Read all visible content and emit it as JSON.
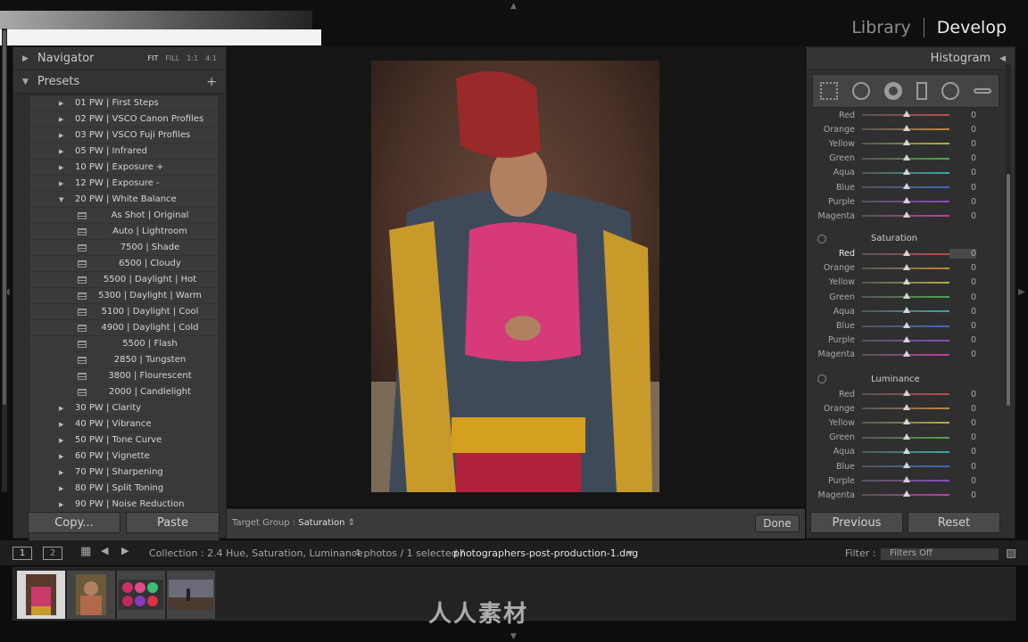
{
  "header": {
    "library": "Library",
    "develop": "Develop"
  },
  "navigator": {
    "title": "Navigator",
    "zoom": [
      "FIT",
      "FILL",
      "1:1",
      "4:1"
    ]
  },
  "presets": {
    "title": "Presets",
    "items": [
      {
        "label": "01 PW | First Steps",
        "type": "folder"
      },
      {
        "label": "02 PW | VSCO Canon Profiles",
        "type": "folder"
      },
      {
        "label": "03 PW | VSCO Fuji Profiles",
        "type": "folder"
      },
      {
        "label": "05 PW | Infrared",
        "type": "folder"
      },
      {
        "label": "10 PW | Exposure +",
        "type": "folder"
      },
      {
        "label": "12 PW | Exposure -",
        "type": "folder"
      },
      {
        "label": "20 PW | White Balance",
        "type": "open"
      },
      {
        "label": "As Shot | Original",
        "type": "sub"
      },
      {
        "label": "Auto | Lightroom",
        "type": "sub"
      },
      {
        "label": "7500 | Shade",
        "type": "sub"
      },
      {
        "label": "6500 | Cloudy",
        "type": "sub"
      },
      {
        "label": "5500 | Daylight | Hot",
        "type": "sub"
      },
      {
        "label": "5300 | Daylight | Warm",
        "type": "sub"
      },
      {
        "label": "5100 | Daylight | Cool",
        "type": "sub"
      },
      {
        "label": "4900 | Daylight | Cold",
        "type": "sub"
      },
      {
        "label": "5500 | Flash",
        "type": "sub"
      },
      {
        "label": "2850 | Tungsten",
        "type": "sub"
      },
      {
        "label": "3800 | Flourescent",
        "type": "sub"
      },
      {
        "label": "2000 | Candlelight",
        "type": "sub"
      },
      {
        "label": "30 PW | Clarity",
        "type": "folder"
      },
      {
        "label": "40 PW | Vibrance",
        "type": "folder"
      },
      {
        "label": "50 PW | Tone Curve",
        "type": "folder"
      },
      {
        "label": "60 PW | Vignette",
        "type": "folder"
      },
      {
        "label": "70 PW | Sharpening",
        "type": "folder"
      },
      {
        "label": "80 PW | Split Toning",
        "type": "folder"
      },
      {
        "label": "90 PW | Noise Reduction",
        "type": "folder"
      }
    ]
  },
  "left_buttons": {
    "copy": "Copy...",
    "paste": "Paste"
  },
  "toolbar": {
    "target_label": "Target Group :",
    "target_value": "Saturation",
    "done": "Done"
  },
  "histogram": {
    "title": "Histogram"
  },
  "hsl": {
    "colors": [
      {
        "name": "Red",
        "color": "#c04a4a"
      },
      {
        "name": "Orange",
        "color": "#c4843a"
      },
      {
        "name": "Yellow",
        "color": "#b5b23a"
      },
      {
        "name": "Green",
        "color": "#4aa84a"
      },
      {
        "name": "Aqua",
        "color": "#3aa8a8"
      },
      {
        "name": "Blue",
        "color": "#3a6ac4"
      },
      {
        "name": "Purple",
        "color": "#8a4ac4"
      },
      {
        "name": "Magenta",
        "color": "#c43aa8"
      }
    ],
    "hue_values": [
      "0",
      "0",
      "0",
      "0",
      "0",
      "0",
      "0",
      "0"
    ],
    "saturation_title": "Saturation",
    "saturation_values": [
      "0",
      "0",
      "0",
      "0",
      "0",
      "0",
      "0",
      "0"
    ],
    "luminance_title": "Luminance",
    "luminance_values": [
      "0",
      "0",
      "0",
      "0",
      "0",
      "0",
      "0",
      "0"
    ]
  },
  "right_buttons": {
    "previous": "Previous",
    "reset": "Reset"
  },
  "filmbar": {
    "page1": "1",
    "page2": "2",
    "collection": "Collection : 2.4 Hue, Saturation, Luminance",
    "count": "4 photos / 1 selected /",
    "filename": "photographers-post-production-1.dng",
    "filter_label": "Filter :",
    "filter_value": "Filters Off"
  },
  "watermark": "人人素材"
}
